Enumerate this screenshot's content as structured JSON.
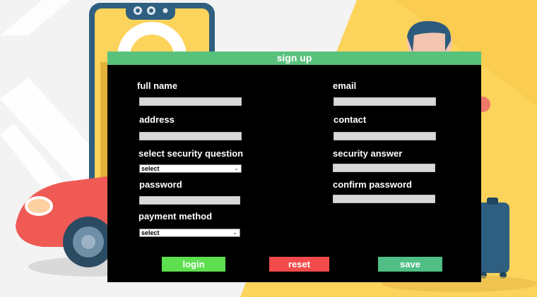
{
  "window": {
    "title": "sign up"
  },
  "form": {
    "full_name_label": "full name",
    "email_label": "email",
    "address_label": "address",
    "contact_label": "contact",
    "security_question_label": "select security question",
    "security_question_value": "select",
    "security_answer_label": "security answer",
    "password_label": "password",
    "confirm_password_label": "confirm password",
    "payment_method_label": "payment method",
    "payment_method_value": "select"
  },
  "buttons": {
    "login": "login",
    "reset": "reset",
    "save": "save"
  },
  "colors": {
    "title_bar": "#58c27d",
    "login": "#5ddf4f",
    "reset": "#f24b4b",
    "save": "#4fbf86",
    "background_yellow": "#fcd35b"
  },
  "icons": {
    "dropdown": "chevron-down-icon"
  }
}
